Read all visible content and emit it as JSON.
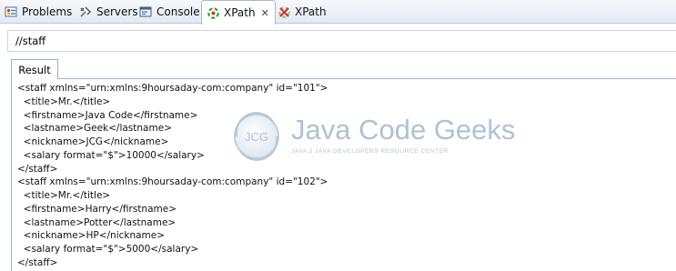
{
  "tabs": [
    {
      "label": "Problems",
      "icon": "problems-icon"
    },
    {
      "label": "Servers",
      "icon": "servers-icon"
    },
    {
      "label": "Console",
      "icon": "console-icon"
    },
    {
      "label": "XPath",
      "icon": "xpath-icon",
      "active": true
    },
    {
      "label": "XPath",
      "icon": "xpath-disabled-icon"
    }
  ],
  "xpath_query": "//staff",
  "result_tab_label": "Result",
  "result_lines": [
    "<staff xmlns=\"urn:xmlns:9hoursaday-com:company\" id=\"101\">",
    "  <title>Mr.</title>",
    "  <firstname>Java Code</firstname>",
    "  <lastname>Geek</lastname>",
    "  <nickname>JCG</nickname>",
    "  <salary format=\"$\">10000</salary>",
    "</staff>",
    "<staff xmlns=\"urn:xmlns:9hoursaday-com:company\" id=\"102\">",
    "  <title>Mr.</title>",
    "  <firstname>Harry</firstname>",
    "  <lastname>Potter</lastname>",
    "  <nickname>HP</nickname>",
    "  <salary format=\"$\">5000</salary>",
    "</staff>"
  ],
  "watermark": {
    "logo_text": "JCG",
    "title": "Java Code Geeks",
    "subtitle": "JAVA 2 JAVA DEVELOPERS RESOURCE CENTER"
  },
  "colors": {
    "accent": "#6f8fb3",
    "tab_border": "#a9b8cc"
  }
}
